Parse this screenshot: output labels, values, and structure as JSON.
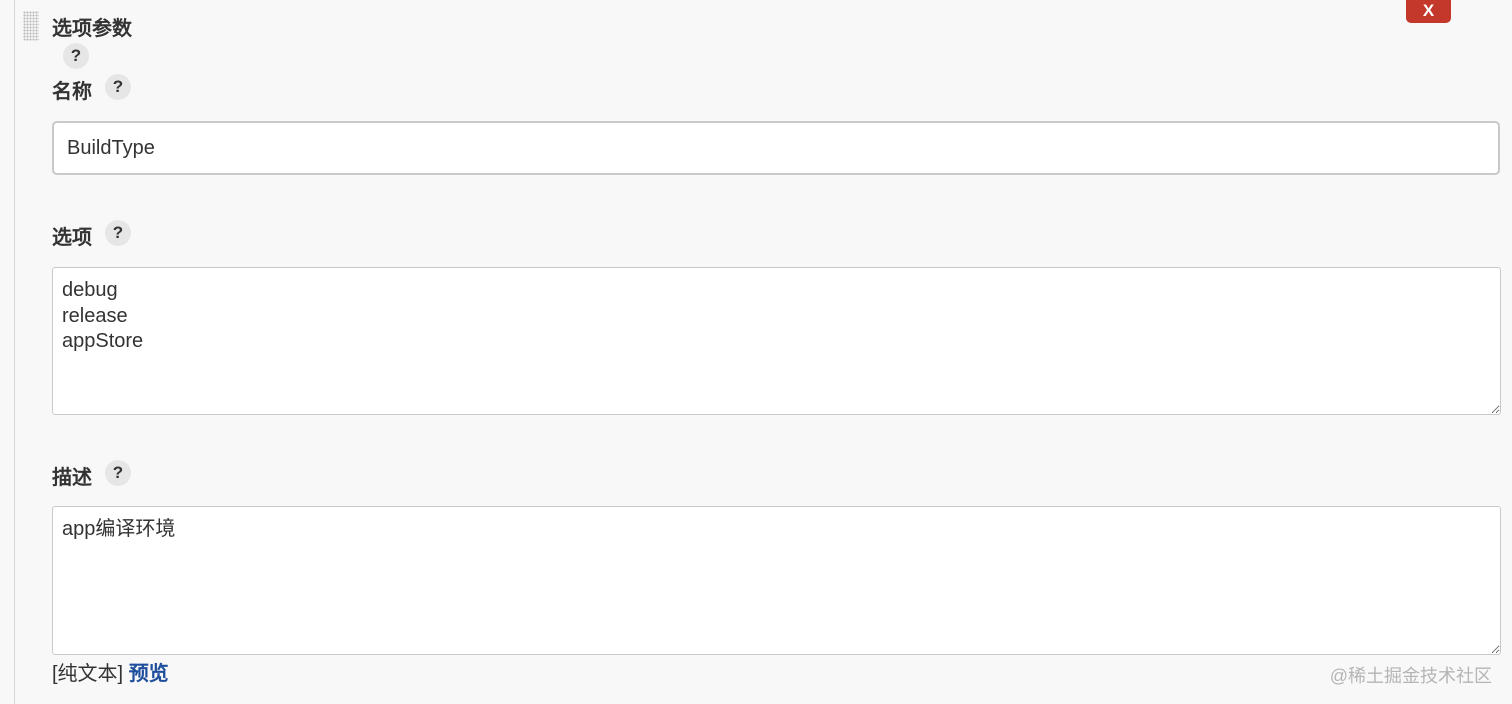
{
  "section": {
    "title": "选项参数",
    "close_label": "X",
    "help_label": "?"
  },
  "fields": {
    "name": {
      "label": "名称",
      "value": "BuildType",
      "help_label": "?"
    },
    "choices": {
      "label": "选项",
      "value": "debug\nrelease\nappStore",
      "help_label": "?"
    },
    "description": {
      "label": "描述",
      "value": "app编译环境",
      "help_label": "?"
    }
  },
  "footer": {
    "plain_text": "[纯文本]",
    "preview_link": "预览"
  },
  "watermark": "@稀土掘金技术社区"
}
